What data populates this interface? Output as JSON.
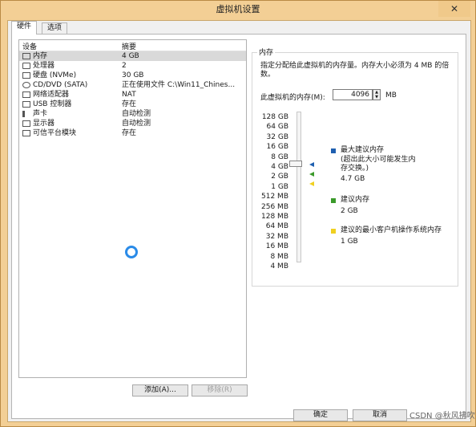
{
  "window": {
    "title": "虚拟机设置",
    "close_glyph": "✕"
  },
  "tabs": [
    {
      "label": "硬件"
    },
    {
      "label": "选项"
    }
  ],
  "device_list": {
    "col_device": "设备",
    "col_summary": "摘要",
    "rows": [
      {
        "name": "内存",
        "summary": "4 GB",
        "icon": "memory-icon"
      },
      {
        "name": "处理器",
        "summary": "2",
        "icon": "cpu-icon"
      },
      {
        "name": "硬盘 (NVMe)",
        "summary": "30 GB",
        "icon": "disk-icon"
      },
      {
        "name": "CD/DVD (SATA)",
        "summary": "正在使用文件 C:\\Win11_Chines...",
        "icon": "cd-icon"
      },
      {
        "name": "网络适配器",
        "summary": "NAT",
        "icon": "network-icon"
      },
      {
        "name": "USB 控制器",
        "summary": "存在",
        "icon": "usb-icon"
      },
      {
        "name": "声卡",
        "summary": "自动检测",
        "icon": "sound-icon"
      },
      {
        "name": "显示器",
        "summary": "自动检测",
        "icon": "display-icon"
      },
      {
        "name": "可信平台模块",
        "summary": "存在",
        "icon": "tpm-icon"
      }
    ]
  },
  "buttons": {
    "add": "添加(A)...",
    "remove": "移除(R)",
    "ok": "确定",
    "cancel": "取消"
  },
  "memory": {
    "group_title": "内存",
    "description": "指定分配给此虚拟机的内存量。内存大小必须为 4 MB 的倍数。",
    "field_label": "此虚拟机的内存(M):",
    "value": "4096",
    "unit": "MB",
    "scale": [
      "128 GB",
      "64 GB",
      "32 GB",
      "16 GB",
      "8 GB",
      "4 GB",
      "2 GB",
      "1 GB",
      "512 MB",
      "256 MB",
      "128 MB",
      "64 MB",
      "32 MB",
      "16 MB",
      "8 MB",
      "4 MB"
    ],
    "legend": {
      "max_label": "最大建议内存",
      "max_note": "(超出此大小可能发生内存交换。)",
      "max_value": "4.7 GB",
      "rec_label": "建议内存",
      "rec_value": "2 GB",
      "min_label": "建议的最小客户机操作系统内存",
      "min_value": "1 GB"
    },
    "colors": {
      "max": "#1f5fb0",
      "rec": "#3a9a2a",
      "min": "#f0d020"
    }
  },
  "watermark": "CSDN @秋风拂吹"
}
